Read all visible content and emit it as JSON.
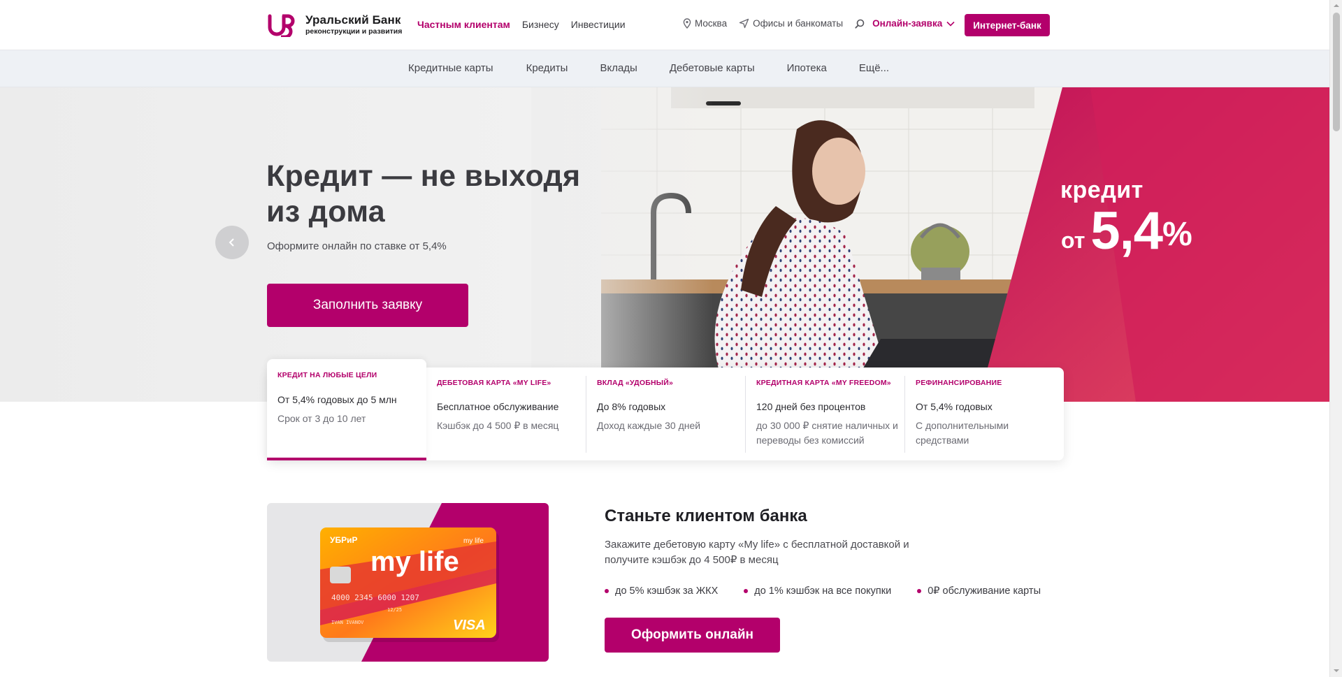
{
  "header": {
    "logo": {
      "mark": "UB",
      "name": "Уральский Банк",
      "tagline": "реконструкции и развития"
    },
    "segments": [
      {
        "label": "Частным клиентам",
        "active": true
      },
      {
        "label": "Бизнесу",
        "active": false
      },
      {
        "label": "Инвестиции",
        "active": false
      }
    ],
    "city": "Москва",
    "offices": "Офисы и банкоматы",
    "online_request": "Онлайн-заявка",
    "internet_bank": "Интернет-банк"
  },
  "subnav": [
    "Кредитные карты",
    "Кредиты",
    "Вклады",
    "Дебетовые карты",
    "Ипотека",
    "Ещё..."
  ],
  "hero": {
    "title": "Кредит — не выходя из дома",
    "subtitle": "Оформите онлайн по ставке от 5,4%",
    "button": "Заполнить заявку",
    "promo_word": "кредит",
    "promo_prefix": "от",
    "promo_rate": "5,4",
    "promo_percent": "%"
  },
  "product_tabs": [
    {
      "caption": "Кредит на любые цели",
      "line1": "От 5,4% годовых до 5 млн",
      "line2": "Срок от 3 до 10 лет",
      "active": true
    },
    {
      "caption": "Дебетовая карта «My life»",
      "line1": "Бесплатное обслуживание",
      "line2": "Кэшбэк до 4 500 ₽ в месяц",
      "active": false
    },
    {
      "caption": "Вклад «Удобный»",
      "line1": "До 8% годовых",
      "line2": "Доход каждые 30 дней",
      "active": false
    },
    {
      "caption": "Кредитная карта «My freedom»",
      "line1": "120 дней без процентов",
      "line2": "до 30 000 ₽ снятие наличных и переводы без комиссий",
      "active": false
    },
    {
      "caption": "Рефинансирование",
      "line1": "От 5,4% годовых",
      "line2": "С дополнительными средствами",
      "active": false
    }
  ],
  "client_block": {
    "title": "Станьте клиентом банка",
    "text": "Закажите дебетовую карту «My life» с бесплатной доставкой и получите кэшбэк до 4 500₽ в месяц",
    "bullets": [
      "до 5% кэшбэк за ЖКХ",
      "до 1% кэшбэк на все покупки",
      "0₽ обслуживание карты"
    ],
    "button": "Оформить онлайн",
    "card": {
      "brand": "УБРиР",
      "corner_label": "my life",
      "big_label": "my life",
      "number": "4000  2345  6000  1207",
      "expiry": "12/25",
      "holder": "IVAN IVANOV",
      "network": "VISA"
    }
  },
  "colors": {
    "brand": "#b3006b",
    "subnav_bg": "#eef1f5",
    "text": "#2b2b2b"
  }
}
